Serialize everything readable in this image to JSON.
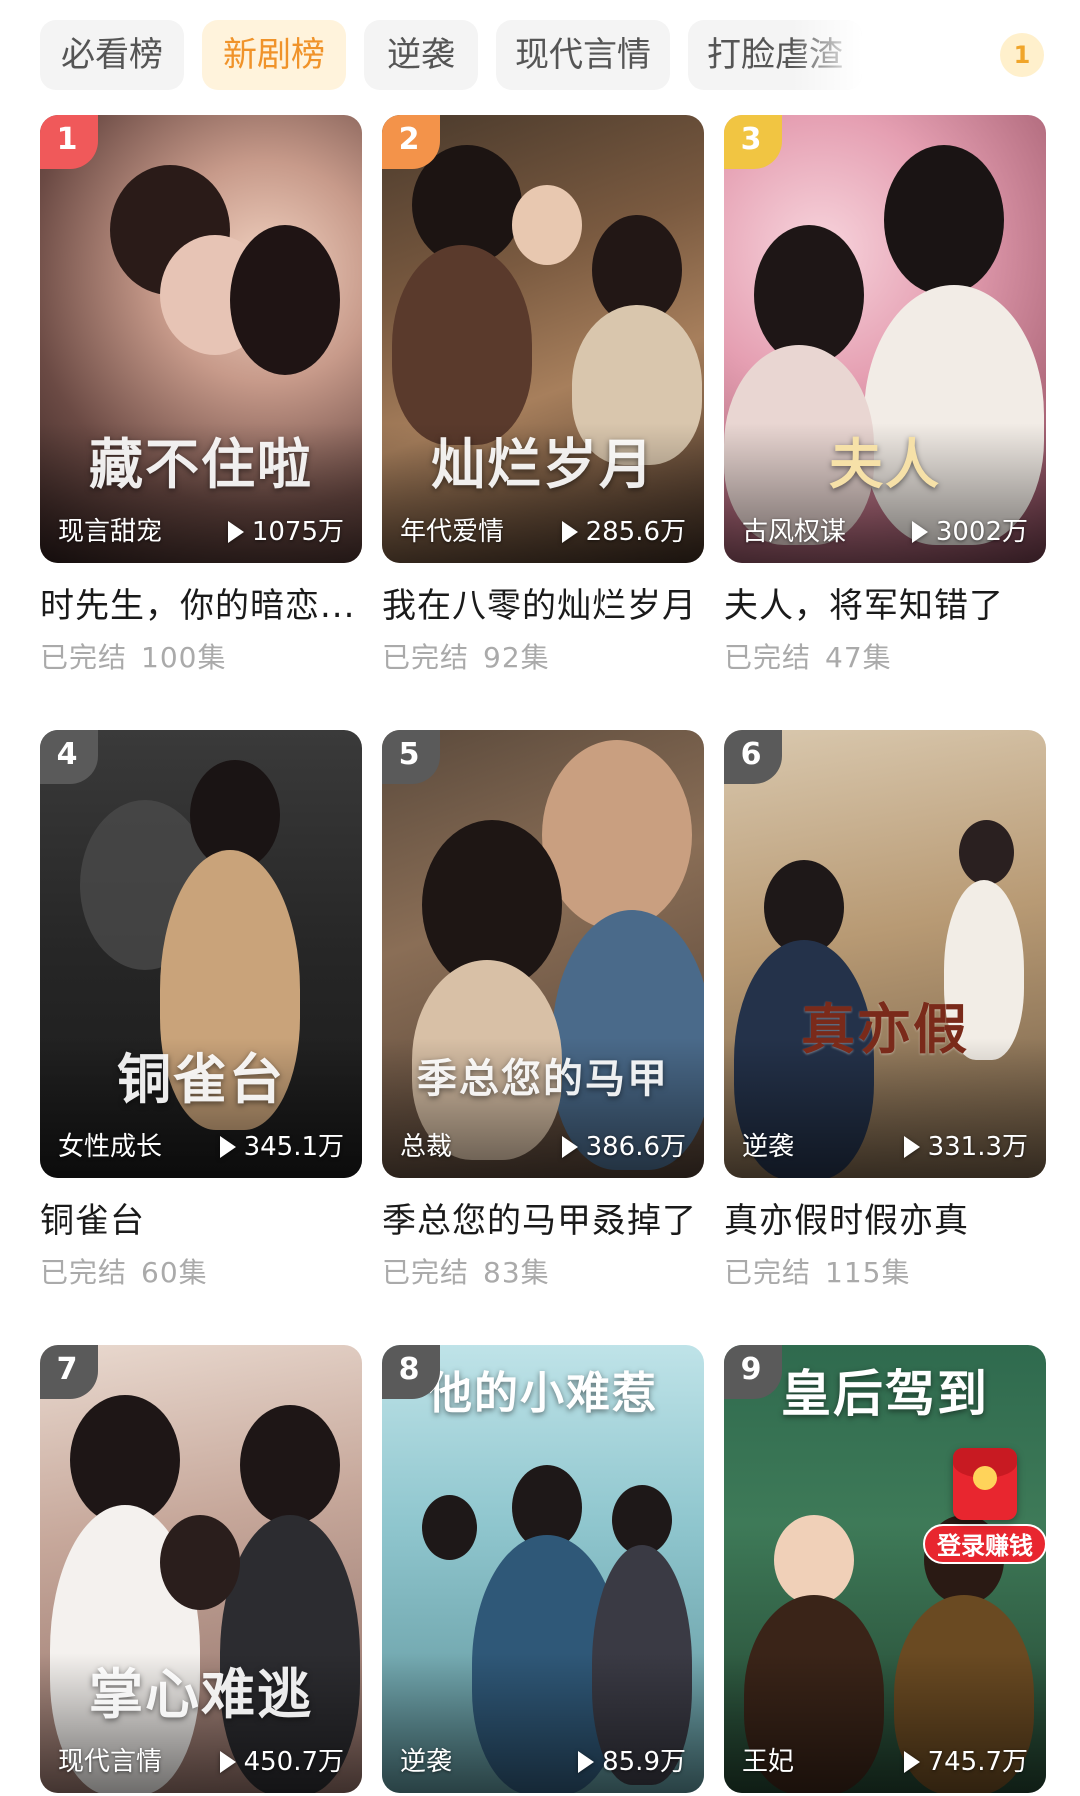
{
  "tabs": [
    {
      "label": "必看榜",
      "active": false
    },
    {
      "label": "新剧榜",
      "active": true
    },
    {
      "label": "逆袭",
      "active": false
    },
    {
      "label": "现代言情",
      "active": false
    },
    {
      "label": "打脸虐渣",
      "active": false
    }
  ],
  "tabs_more_badge": "1",
  "colors": {
    "accent": "#f0932a",
    "rank1": "#f0595a",
    "rank2": "#f3934a",
    "rank3": "#f1c542",
    "rank_default": "#5a5a5a",
    "reward_red": "#e8262f"
  },
  "dramas": [
    {
      "rank": "1",
      "title": "时先生，你的暗恋...",
      "poster_text": "藏不住啦",
      "genre": "现言甜宠",
      "views": "1075万",
      "status": "已完结",
      "episodes": "100集"
    },
    {
      "rank": "2",
      "title": "我在八零的灿烂岁月",
      "poster_text": "灿烂岁月",
      "genre": "年代爱情",
      "views": "285.6万",
      "status": "已完结",
      "episodes": "92集"
    },
    {
      "rank": "3",
      "title": "夫人，将军知错了",
      "poster_text": "夫人",
      "genre": "古风权谋",
      "views": "3002万",
      "status": "已完结",
      "episodes": "47集"
    },
    {
      "rank": "4",
      "title": "铜雀台",
      "poster_text": "铜雀台",
      "genre": "女性成长",
      "views": "345.1万",
      "status": "已完结",
      "episodes": "60集"
    },
    {
      "rank": "5",
      "title": "季总您的马甲叒掉了",
      "poster_text": "季总您的马甲",
      "genre": "总裁",
      "views": "386.6万",
      "status": "已完结",
      "episodes": "83集"
    },
    {
      "rank": "6",
      "title": "真亦假时假亦真",
      "poster_text": "真亦假",
      "genre": "逆袭",
      "views": "331.3万",
      "status": "已完结",
      "episodes": "115集"
    },
    {
      "rank": "7",
      "title": "",
      "poster_text": "掌心难逃",
      "genre": "现代言情",
      "views": "450.7万",
      "status": "",
      "episodes": ""
    },
    {
      "rank": "8",
      "title": "",
      "poster_text": "他的小难惹",
      "genre": "逆袭",
      "views": "85.9万",
      "status": "",
      "episodes": ""
    },
    {
      "rank": "9",
      "title": "",
      "poster_text": "皇后驾到",
      "genre": "王妃",
      "views": "745.7万",
      "status": "",
      "episodes": ""
    }
  ],
  "reward": {
    "label": "登录赚钱",
    "icon": "red-envelope-icon"
  }
}
